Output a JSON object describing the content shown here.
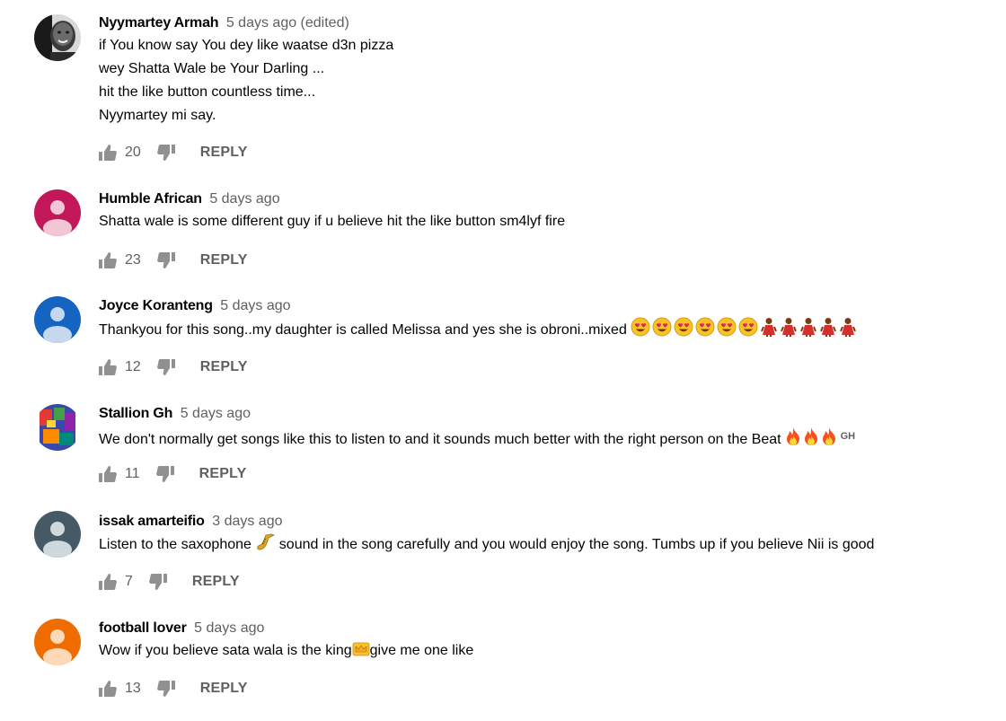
{
  "comments": [
    {
      "author": "Nyymartey Armah",
      "time": "5 days ago (edited)",
      "lines": [
        "if You know say You dey like waatse d3n pizza",
        "wey Shatta Wale be Your Darling ...",
        "hit the like button countless time...",
        "Nyymartey mi say."
      ],
      "likes": "20",
      "reply": "REPLY",
      "avatar": {
        "type": "photo",
        "color": "#3a3a3a"
      }
    },
    {
      "author": "Humble African",
      "time": "5 days ago",
      "lines": [
        "Shatta wale is some different guy if u believe hit the like button sm4lyf fire"
      ],
      "likes": "23",
      "reply": "REPLY",
      "avatar": {
        "type": "default",
        "color": "#c2185b"
      }
    },
    {
      "author": "Joyce Koranteng",
      "time": "5 days ago",
      "lines": [
        "Thankyou for this song..my daughter is called Melissa and yes she is obroni..mixed"
      ],
      "emojis": [
        "heart-eyes-face-icon",
        "heart-eyes-face-icon",
        "heart-eyes-face-icon",
        "heart-eyes-face-icon",
        "heart-eyes-face-icon",
        "heart-eyes-face-icon",
        "woman-figure-icon",
        "woman-figure-icon",
        "woman-figure-icon",
        "woman-figure-icon",
        "woman-figure-icon"
      ],
      "likes": "12",
      "reply": "REPLY",
      "avatar": {
        "type": "default",
        "color": "#1565c0"
      }
    },
    {
      "author": "Stallion Gh",
      "time": "5 days ago",
      "lines": [
        "We don't normally get songs like this to listen to and it sounds much better with the right person on the Beat"
      ],
      "emojis": [
        "fire-icon",
        "fire-icon",
        "fire-icon"
      ],
      "suffix": "GH",
      "likes": "11",
      "reply": "REPLY",
      "avatar": {
        "type": "photo",
        "color": "#5c6bc0"
      }
    },
    {
      "author": "issak amarteifio",
      "time": "3 days ago",
      "lines_parts": {
        "before": "Listen to the saxophone",
        "after": " sound in the song  carefully and you would enjoy the song. Tumbs up if you believe Nii is good"
      },
      "lines": [],
      "emojis": [
        "saxophone-icon"
      ],
      "likes": "7",
      "reply": "REPLY",
      "avatar": {
        "type": "default",
        "color": "#455a64"
      }
    },
    {
      "author": "football lover",
      "time": "5 days ago",
      "lines_parts": {
        "before": "Wow if you believe sata wala is the king",
        "after": "give me one like"
      },
      "lines": [],
      "emojis": [
        "crown-icon"
      ],
      "likes": "13",
      "reply": "REPLY",
      "avatar": {
        "type": "default",
        "color": "#ef6c00"
      }
    }
  ],
  "colors": {
    "author": "#030303",
    "meta": "#606060",
    "text": "#030303"
  }
}
